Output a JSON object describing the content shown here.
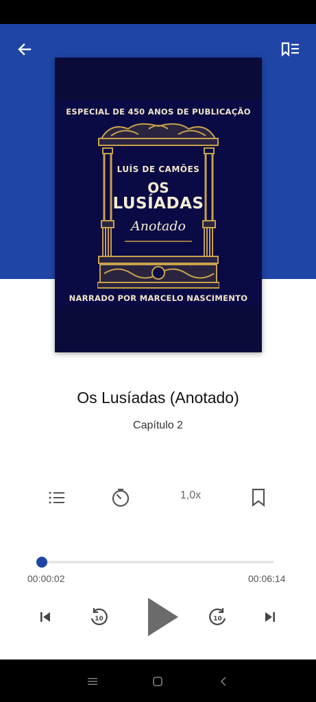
{
  "cover": {
    "top_text": "ESPECIAL DE 450 ANOS DE PUBLICAÇÃO",
    "author": "LUÍS DE CAMÕES",
    "title_line1": "OS",
    "title_line2": "LUSÍADAS",
    "subtitle": "Anotado",
    "narrator": "NARRADO POR MARCELO NASCIMENTO"
  },
  "book": {
    "title": "Os Lusíadas (Anotado)",
    "chapter": "Capítulo 2"
  },
  "controls": {
    "speed": "1,0x"
  },
  "progress": {
    "elapsed": "00:00:02",
    "total": "00:06:14",
    "fraction": 0.005
  },
  "colors": {
    "accent": "#1f46a6",
    "cover_bg": "#0a0a45",
    "gold": "#c9a24a"
  },
  "icons": {
    "back": "arrow-left-icon",
    "bookmarks": "bookmark-list-icon",
    "chapters": "list-icon",
    "timer": "sleep-timer-icon",
    "bookmark": "bookmark-icon",
    "prev": "skip-previous-icon",
    "rewind": "replay-10-icon",
    "play": "play-icon",
    "forward": "forward-10-icon",
    "next": "skip-next-icon"
  }
}
